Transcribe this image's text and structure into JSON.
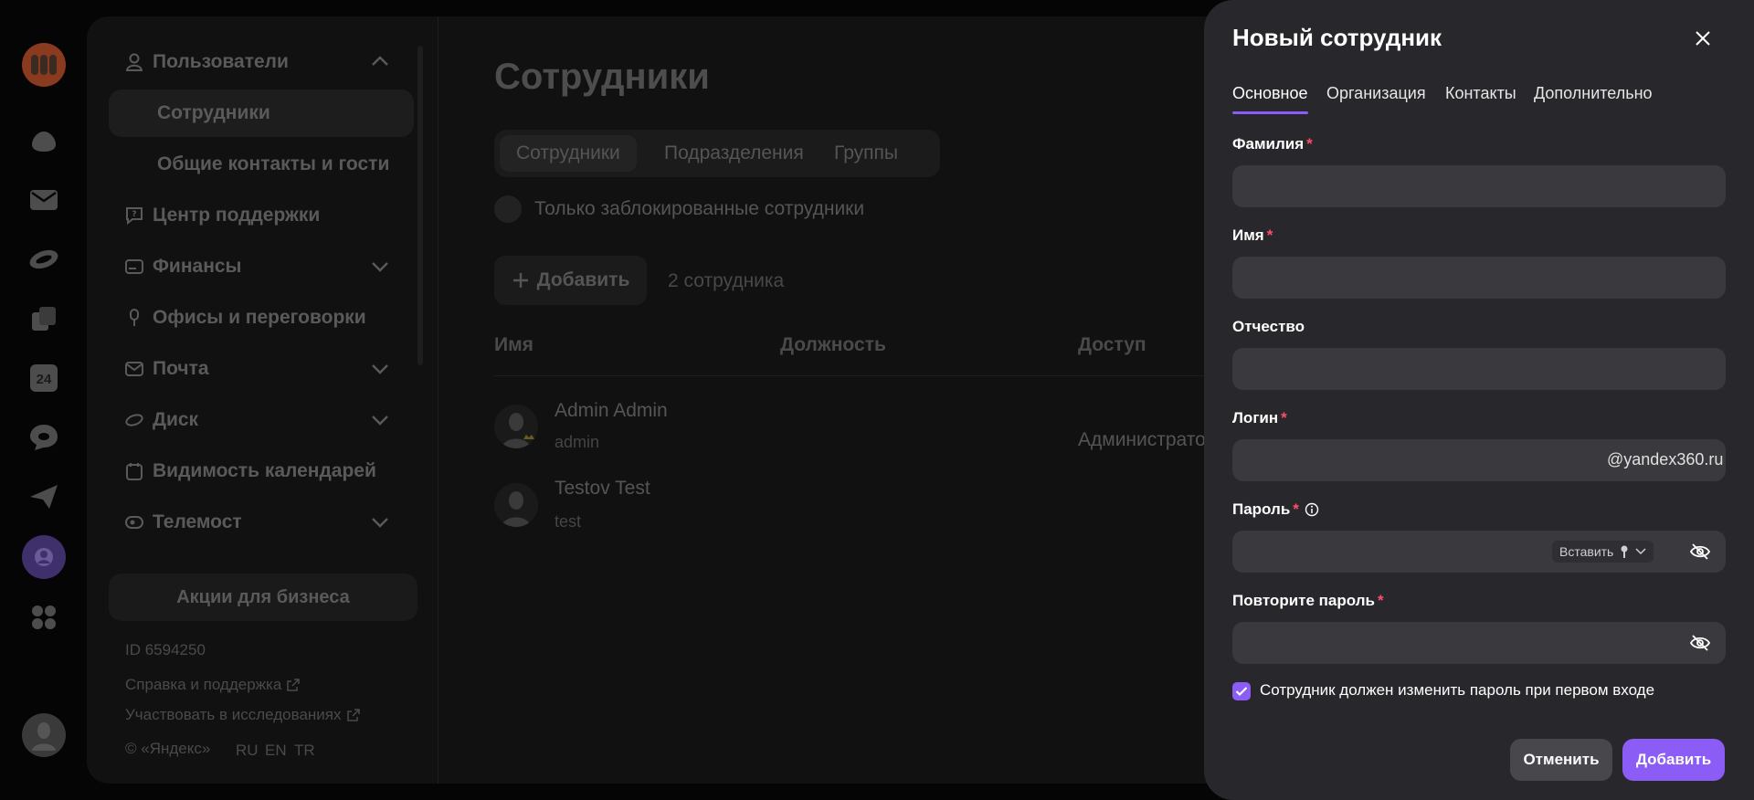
{
  "rail": {
    "icons": [
      "yandex360-logo-icon",
      "cloud-icon",
      "mail-icon",
      "disk-icon",
      "documents-icon",
      "calendar-icon",
      "messenger-icon",
      "telemost-icon",
      "admin-icon",
      "apps-icon",
      "user-avatar-icon"
    ],
    "calendar_day": "24"
  },
  "nav": {
    "users": "Пользователи",
    "employees": "Сотрудники",
    "contacts": "Общие контакты и гости",
    "support": "Центр поддержки",
    "finance": "Финансы",
    "offices": "Офисы и переговорки",
    "mail": "Почта",
    "disk": "Диск",
    "calendars": "Видимость календарей",
    "telemost": "Телемост",
    "promo": "Акции для бизнеса",
    "id": "ID 6594250",
    "help": "Справка и поддержка",
    "research": "Участвовать в исследованиях",
    "copyright": "© «Яндекс»",
    "langs": [
      "RU",
      "EN",
      "TR"
    ]
  },
  "content": {
    "title": "Сотрудники",
    "tabs": [
      "Сотрудники",
      "Подразделения",
      "Группы"
    ],
    "blocked_only": "Только заблокированные сотрудники",
    "add_label": "Добавить",
    "count": "2 сотрудника",
    "columns": [
      "Имя",
      "Должность",
      "Доступ"
    ],
    "rows": [
      {
        "name": "Admin Admin",
        "login": "admin",
        "access": "Администратор"
      },
      {
        "name": "Testov Test",
        "login": "test",
        "access": ""
      }
    ]
  },
  "modal": {
    "title": "Новый сотрудник",
    "tabs": [
      "Основное",
      "Организация",
      "Контакты",
      "Дополнительно"
    ],
    "fields": {
      "last_name": {
        "label": "Фамилия",
        "value": ""
      },
      "first_name": {
        "label": "Имя",
        "value": ""
      },
      "middle_name": {
        "label": "Отчество",
        "value": ""
      },
      "login": {
        "label": "Логин",
        "value": "",
        "suffix": "@yandex360.ru"
      },
      "password": {
        "label": "Пароль",
        "value": "",
        "paste": "Вставить"
      },
      "password_repeat": {
        "label": "Повторите пароль",
        "value": ""
      }
    },
    "required_mark": "*",
    "change_password": {
      "label": "Сотрудник должен изменить пароль при первом входе",
      "checked": true
    },
    "cancel": "Отменить",
    "submit": "Добавить"
  },
  "colors": {
    "accent": "#8b5cf6",
    "required": "#ff4d6a",
    "modal_bg": "#28272b",
    "field_bg": "#3a393d"
  }
}
